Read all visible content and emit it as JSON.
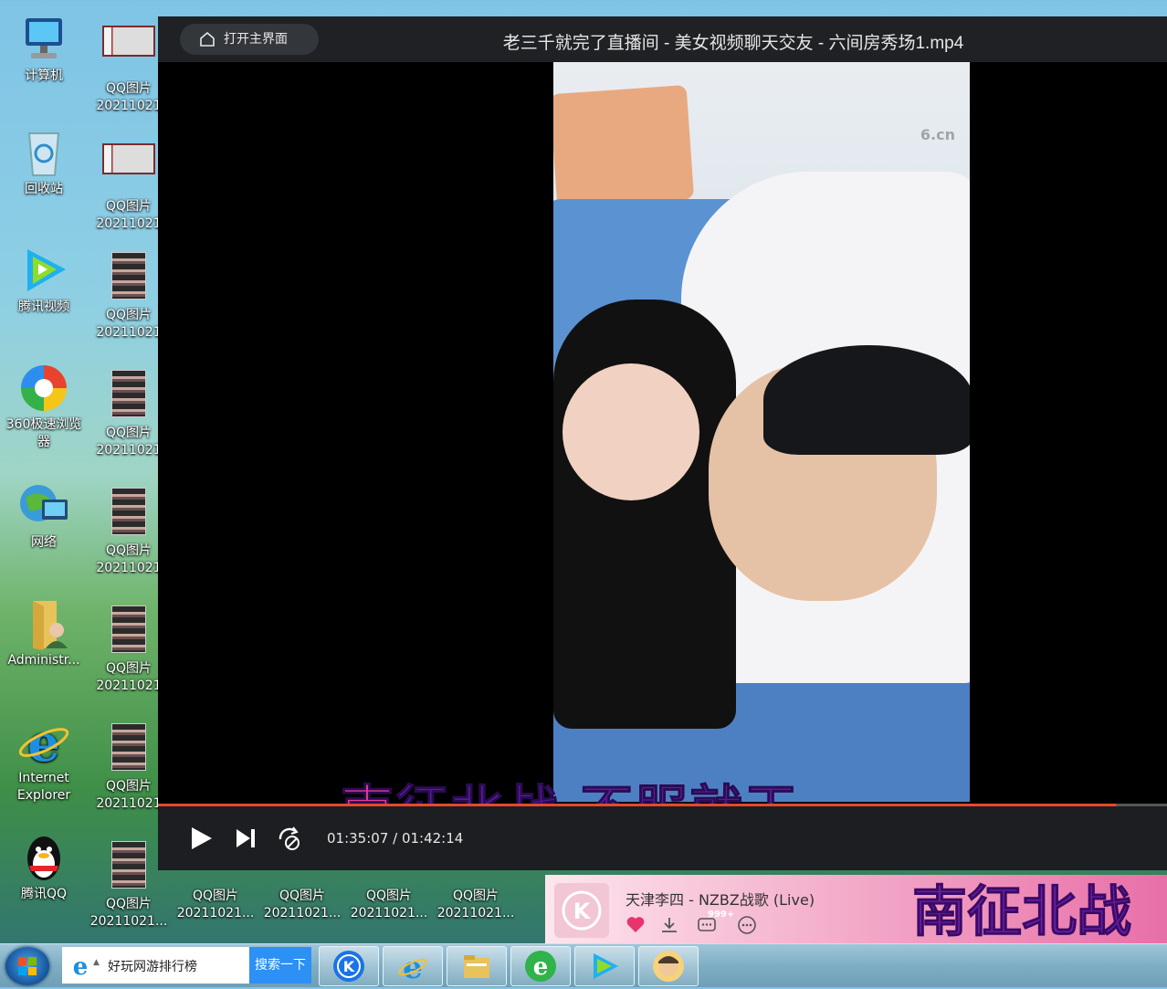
{
  "desktop": {
    "col1": [
      {
        "label": "计算机"
      },
      {
        "label": "回收站"
      },
      {
        "label": "腾讯视频"
      },
      {
        "label": "360极速浏览器"
      },
      {
        "label": "网络"
      },
      {
        "label": "Administr..."
      },
      {
        "label": "Internet Explorer"
      },
      {
        "label": "腾讯QQ"
      }
    ],
    "col2": [
      {
        "label1": "QQ图片",
        "label2": "20211021"
      },
      {
        "label1": "QQ图片",
        "label2": "20211021"
      },
      {
        "label1": "QQ图片",
        "label2": "20211021"
      },
      {
        "label1": "QQ图片",
        "label2": "20211021"
      },
      {
        "label1": "QQ图片",
        "label2": "20211021"
      },
      {
        "label1": "QQ图片",
        "label2": "20211021"
      },
      {
        "label1": "QQ图片",
        "label2": "20211021"
      },
      {
        "label1": "QQ图片",
        "label2": "20211021..."
      }
    ],
    "bottom_row": [
      {
        "label1": "QQ图片",
        "label2": "20211021..."
      },
      {
        "label1": "QQ图片",
        "label2": "20211021..."
      },
      {
        "label1": "QQ图片",
        "label2": "20211021..."
      },
      {
        "label1": "QQ图片",
        "label2": "20211021..."
      }
    ]
  },
  "player": {
    "home_button": "打开主界面",
    "title": "老三千就完了直播间 - 美女视频聊天交友 - 六间房秀场1.mp4",
    "video_watermark": "6.cn",
    "subtitle_part1": "南",
    "subtitle_part2": "征北战  不服就干",
    "time": "01:35:07 / 01:42:14",
    "progress_fraction": 0.95
  },
  "music": {
    "song": "天津李四 - NZBZ战歌 (Live)",
    "comment_badge": "999+",
    "lyric_big": "南征北战"
  },
  "taskbar": {
    "search_text": "好玩网游排行榜",
    "search_button": "搜索一下"
  }
}
